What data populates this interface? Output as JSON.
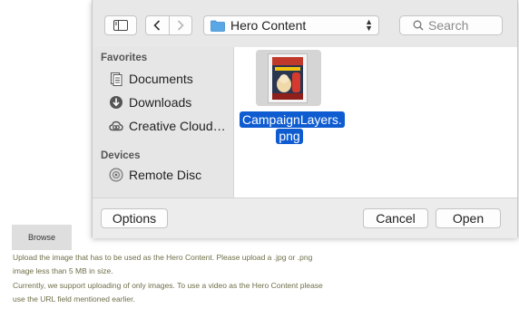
{
  "dialog": {
    "location": "Hero Content",
    "search_placeholder": "Search",
    "sidebar": {
      "favorites_title": "Favorites",
      "favorites": [
        {
          "label": "Documents",
          "icon": "documents-icon"
        },
        {
          "label": "Downloads",
          "icon": "downloads-icon"
        },
        {
          "label": "Creative Cloud…",
          "icon": "creative-cloud-icon"
        }
      ],
      "devices_title": "Devices",
      "devices": [
        {
          "label": "Remote Disc",
          "icon": "disc-icon"
        }
      ]
    },
    "file": {
      "name_line1": "CampaignLayers.",
      "name_line2": "png"
    },
    "buttons": {
      "options": "Options",
      "cancel": "Cancel",
      "open": "Open"
    }
  },
  "page": {
    "browse_label": "Browse",
    "help_lines": [
      "Upload the image that has to be used as the Hero Content. Please upload a .jpg or .png",
      "image less than 5 MB in size.",
      "Currently, we support uploading of only images. To use a video as the Hero Content please",
      "use the URL field mentioned earlier."
    ]
  },
  "colors": {
    "selection": "#0f5cd1",
    "help_text": "#6f6f4a",
    "folder": "#5aa7e6"
  }
}
